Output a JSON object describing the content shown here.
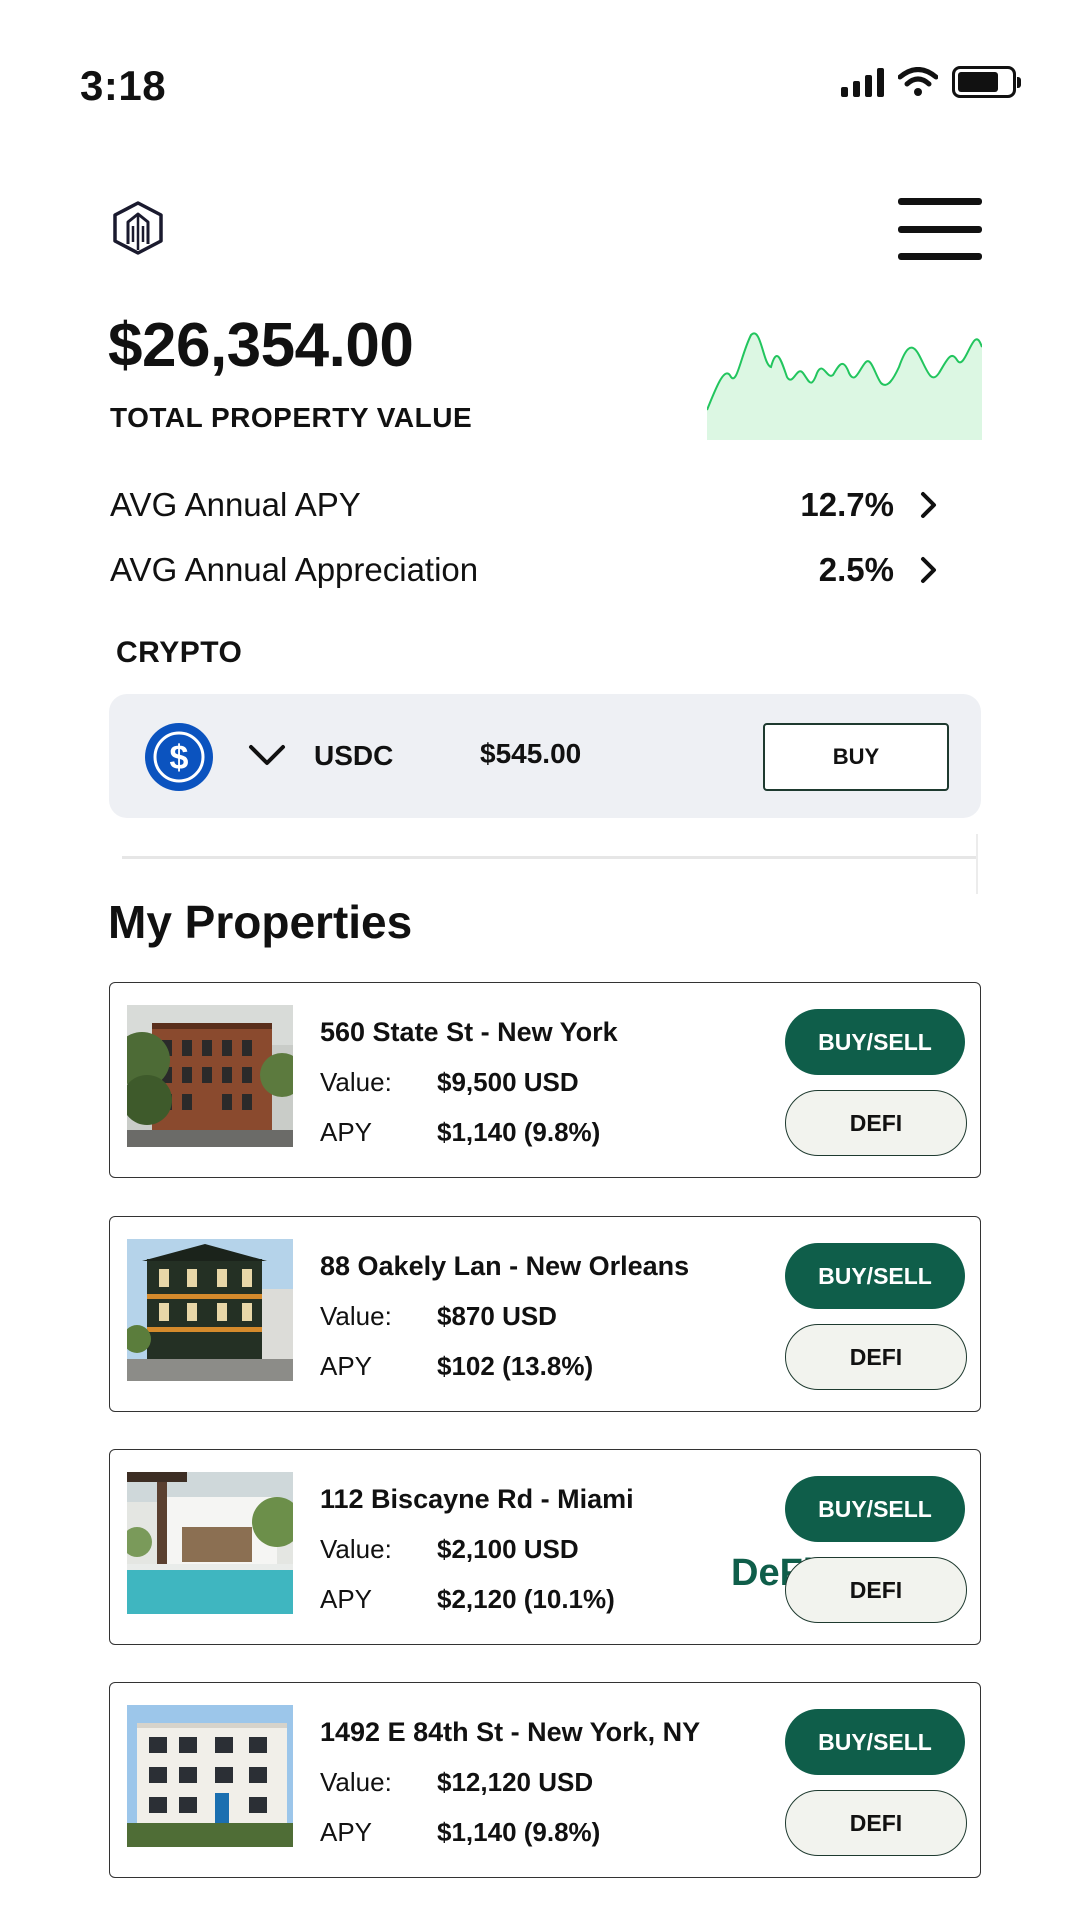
{
  "status_bar": {
    "time": "3:18"
  },
  "portfolio": {
    "total_value": "$26,354.00",
    "total_label": "TOTAL PROPERTY VALUE",
    "sparkline_color": "#22c55e",
    "sparkline_fill": "#dcf7e3"
  },
  "stats": [
    {
      "label": "AVG Annual APY",
      "value": "12.7%"
    },
    {
      "label": "AVG Annual Appreciation",
      "value": "2.5%"
    }
  ],
  "crypto": {
    "heading": "CRYPTO",
    "symbol": "USDC",
    "amount": "$545.00",
    "buy_label": "BUY",
    "icon": "usdc-icon",
    "icon_color": "#0b53bf"
  },
  "properties_title": "My Properties",
  "labels": {
    "value": "Value:",
    "apy": "APY",
    "buy_sell": "BUY/SELL",
    "defi": "DEFI"
  },
  "properties": [
    {
      "address": "560 State St - New York",
      "value": "$9,500 USD",
      "apy": "$1,140 (9.8%)"
    },
    {
      "address": "88 Oakely Lan - New Orleans",
      "value": "$870 USD",
      "apy": "$102 (13.8%)"
    },
    {
      "address": "112 Biscayne Rd - Miami",
      "value": "$2,100 USD",
      "apy": "$2,120 (10.1%)",
      "overlay_text": "DeFi"
    },
    {
      "address": "1492 E 84th  St - New York, NY",
      "value": "$12,120 USD",
      "apy": "$1,140 (9.8%)"
    }
  ],
  "colors": {
    "primary_green": "#0f5e4a",
    "card_bg": "#eef0f4"
  }
}
